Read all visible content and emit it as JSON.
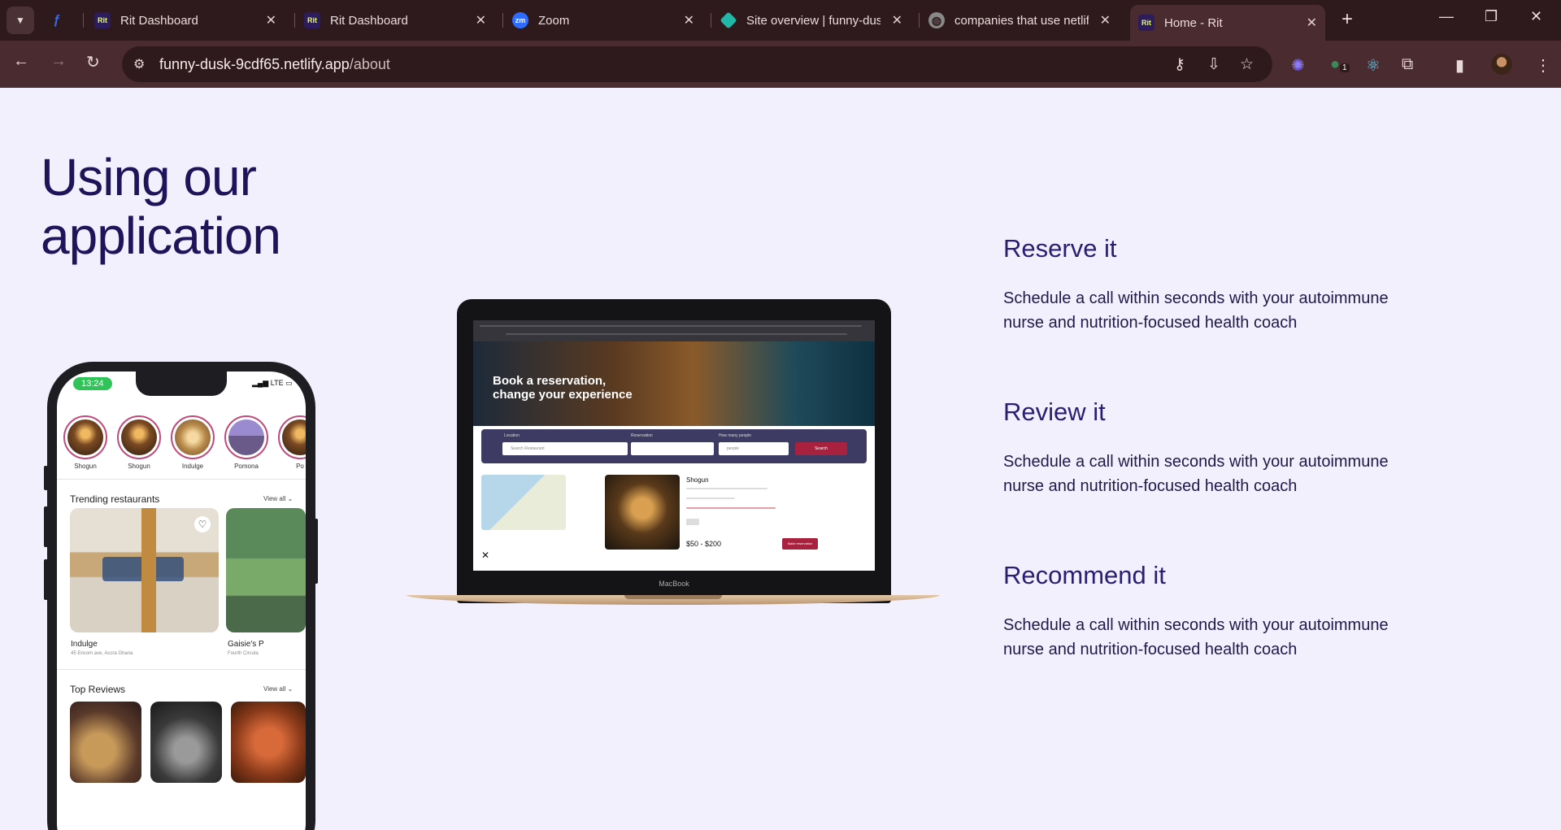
{
  "browser": {
    "tabs": [
      {
        "favicon_text": "",
        "title": "",
        "favicon_color": "#3a6bdc"
      },
      {
        "favicon_text": "Rit",
        "title": "Rit Dashboard",
        "favicon_color": "#2c1c5c"
      },
      {
        "favicon_text": "Rit",
        "title": "Rit Dashboard",
        "favicon_color": "#2c1c5c"
      },
      {
        "favicon_text": "zm",
        "title": "Zoom",
        "favicon_color": "#2d6cff"
      },
      {
        "favicon_text": "",
        "title": "Site overview | funny-dus",
        "favicon_color": "#20b8a8"
      },
      {
        "favicon_text": "",
        "title": "companies that use netlif",
        "favicon_color": "#888888"
      },
      {
        "favicon_text": "Rit",
        "title": "Home - Rit",
        "favicon_color": "#2c1c5c"
      }
    ],
    "url_host": "funny-dusk-9cdf65.netlify.app",
    "url_path": "/about",
    "extension_badge": "1"
  },
  "page": {
    "title_line1": "Using our",
    "title_line2": "application",
    "features": [
      {
        "title": "Reserve it",
        "description": "Schedule a call within seconds with your autoimmune nurse and nutrition-focused health coach"
      },
      {
        "title": "Review it",
        "description": "Schedule a call within seconds with your autoimmune nurse and nutrition-focused health coach"
      },
      {
        "title": "Recommend it",
        "description": "Schedule a call within seconds with your autoimmune nurse and nutrition-focused health coach"
      }
    ]
  },
  "phone": {
    "time": "13:24",
    "status": "LTE",
    "stories": [
      "Shogun",
      "Shogun",
      "Indulge",
      "Pomona",
      "Po"
    ],
    "trending_title": "Trending restaurants",
    "view_all": "View all",
    "trending": [
      {
        "name": "Indulge",
        "address": "45 Encom ave, Accra Ghana"
      },
      {
        "name": "Gaisie's P",
        "address": "Fourth Circula"
      }
    ],
    "reviews_title": "Top Reviews"
  },
  "laptop": {
    "hero_line1": "Book a reservation,",
    "hero_line2": "change your experience",
    "field_labels": [
      "Location",
      "Reservation",
      "How many people"
    ],
    "location_placeholder": "Search Restaurant",
    "people_placeholder": "people",
    "search_btn": "Search",
    "restaurant_name": "Shogun",
    "price": "$50 - $200",
    "reserve_btn": "Make reservation",
    "brand": "MacBook"
  }
}
